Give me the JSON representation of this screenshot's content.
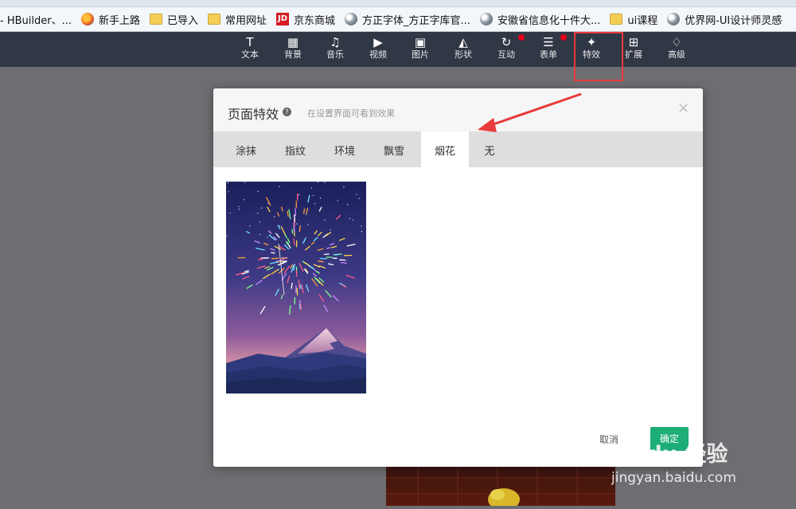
{
  "bookmarks": [
    {
      "label": "- HBuilder、...",
      "icon": "none"
    },
    {
      "label": "新手上路",
      "icon": "firefox-icon"
    },
    {
      "label": "已导入",
      "icon": "folder-icon"
    },
    {
      "label": "常用网址",
      "icon": "folder-icon"
    },
    {
      "label": "京东商城",
      "icon": "jd-icon",
      "icon_text": "JD"
    },
    {
      "label": "方正字体_方正字库官...",
      "icon": "globe-icon"
    },
    {
      "label": "安徽省信息化十件大...",
      "icon": "globe-icon"
    },
    {
      "label": "ui课程",
      "icon": "folder-icon"
    },
    {
      "label": "优界网-UI设计师灵感",
      "icon": "globe-icon"
    }
  ],
  "toolbar": {
    "items": [
      {
        "label": "文本",
        "icon": "text-icon",
        "glyph": "T"
      },
      {
        "label": "背景",
        "icon": "grid-icon",
        "glyph": "▦"
      },
      {
        "label": "音乐",
        "icon": "music-icon",
        "glyph": "♫"
      },
      {
        "label": "视频",
        "icon": "video-icon",
        "glyph": "▶"
      },
      {
        "label": "图片",
        "icon": "image-icon",
        "glyph": "▣"
      },
      {
        "label": "形状",
        "icon": "shape-icon",
        "glyph": "◭"
      },
      {
        "label": "互动",
        "icon": "refresh-icon",
        "glyph": "↻",
        "badge": true
      },
      {
        "label": "表单",
        "icon": "list-icon",
        "glyph": "☰",
        "badge": true
      },
      {
        "label": "特效",
        "icon": "sparkle-icon",
        "glyph": "✦"
      },
      {
        "label": "扩展",
        "icon": "extend-icon",
        "glyph": "⊞"
      },
      {
        "label": "高级",
        "icon": "diamond-icon",
        "glyph": "♢"
      }
    ]
  },
  "dialog": {
    "title": "页面特效",
    "help_glyph": "?",
    "subtitle": "在设置界面可看到效果",
    "close_glyph": "×",
    "tabs": [
      "涂抹",
      "指纹",
      "环境",
      "飘雪",
      "烟花",
      "无"
    ],
    "active_tab": "烟花",
    "cancel_label": "取消",
    "ok_label": "确定"
  },
  "watermark": {
    "brand": "Bai du 经验",
    "url": "jingyan.baidu.com"
  },
  "colors": {
    "toolbar_bg": "#303745",
    "accent_green": "#1dad76",
    "highlight_red": "#e83b3b",
    "badge_red": "#e4001a"
  }
}
